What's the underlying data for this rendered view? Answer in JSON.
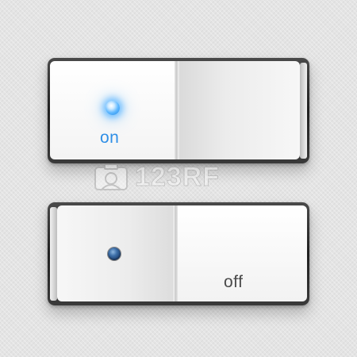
{
  "switches": {
    "on": {
      "label": "on",
      "state": "on",
      "indicator_color": "#3aa0ff",
      "label_color": "#2f8fe6"
    },
    "off": {
      "label": "off",
      "state": "off",
      "indicator_color": "#2a4f80",
      "label_color": "#4a4a4a"
    }
  },
  "watermark": {
    "text": "123RF",
    "icon": "camera-icon"
  },
  "colors": {
    "background": "#e4e4e4",
    "frame": "#2a2a2a",
    "rocker_face": "#f4f4f4"
  }
}
